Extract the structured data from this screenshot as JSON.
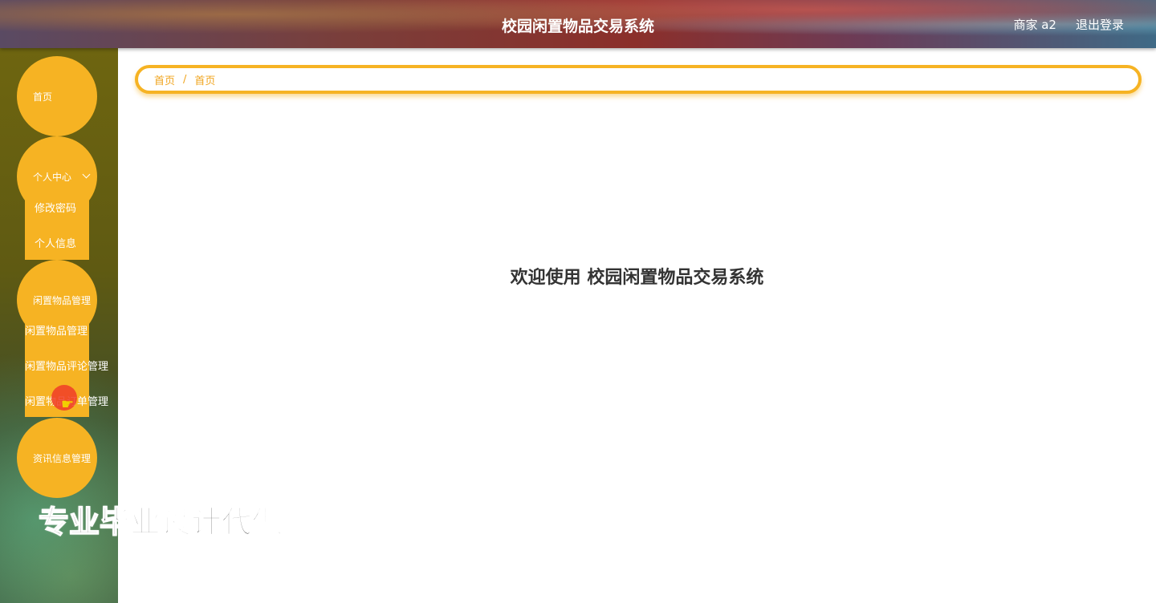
{
  "header": {
    "title": "校园闲置物品交易系统",
    "user_label": "商家 a2",
    "logout_label": "退出登录"
  },
  "sidebar": {
    "items": [
      {
        "label": "首页"
      },
      {
        "label": "个人中心",
        "children": [
          "修改密码",
          "个人信息"
        ]
      },
      {
        "label": "闲置物品管理",
        "children": [
          "闲置物品管理",
          "闲置物品评论管理",
          "闲置物品订单管理"
        ]
      },
      {
        "label": "资讯信息管理"
      }
    ]
  },
  "breadcrumb": {
    "root": "首页",
    "separator": "/",
    "current": "首页"
  },
  "main": {
    "welcome": "欢迎使用 校园闲置物品交易系统"
  },
  "watermark": "专业毕业设计代做",
  "colors": {
    "accent": "#f6b323",
    "text_dark": "#333333"
  }
}
